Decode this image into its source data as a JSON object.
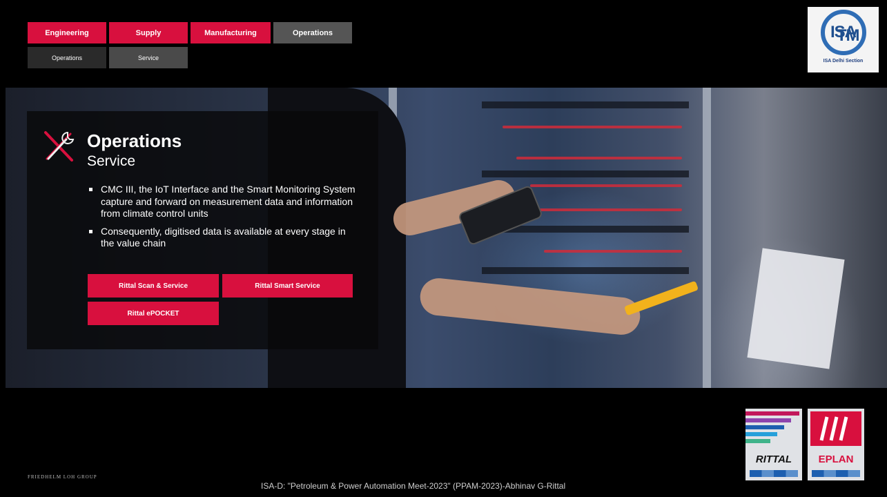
{
  "nav": {
    "top_tabs": [
      {
        "label": "Engineering"
      },
      {
        "label": "Supply"
      },
      {
        "label": "Manufacturing"
      },
      {
        "label": "Operations"
      }
    ],
    "sub_tabs": [
      {
        "label": "Operations"
      },
      {
        "label": "Service"
      }
    ]
  },
  "isa_logo": {
    "mark": "ISA",
    "tm": "TM",
    "caption": "ISA Delhi Section"
  },
  "panel": {
    "icon": "tools-icon",
    "title": "Operations",
    "subtitle": "Service",
    "bullets": [
      "CMC III, the IoT Interface and the Smart Monitoring System capture and forward on measurement data and information from climate control units",
      "Consequently, digitised data is available at every stage in the value chain"
    ],
    "buttons": [
      {
        "label": "Rittal Scan & Service"
      },
      {
        "label": "Rittal Smart Service"
      },
      {
        "label": "Rittal ePOCKET"
      }
    ]
  },
  "footer": {
    "left": "FRIEDHELM LOH GROUP",
    "center": "ISA-D: \"Petroleum & Power Automation Meet-2023\" (PPAM-2023)-Abhinav G-Rittal"
  },
  "partner_logos": [
    {
      "name": "RITTAL",
      "color": "#1d5fb0"
    },
    {
      "name": "EPLAN",
      "color": "#d8103e"
    }
  ],
  "colors": {
    "accent": "#d8103e",
    "nav_inactive": "#555555",
    "background": "#000000"
  }
}
